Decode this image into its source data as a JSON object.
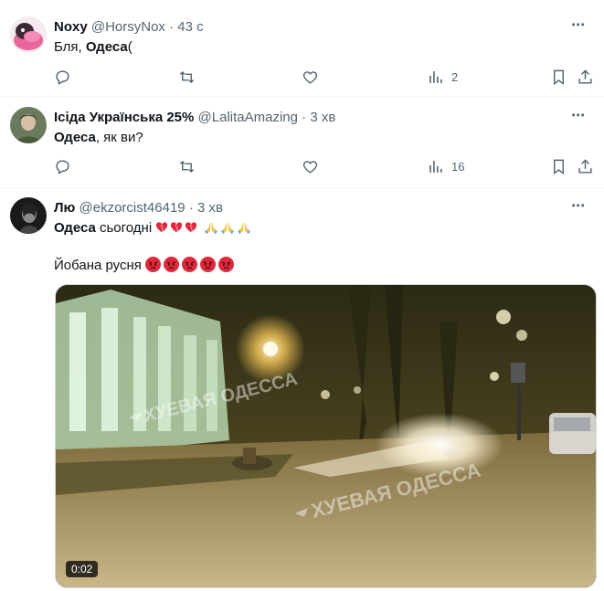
{
  "tweets": [
    {
      "name": "Noxy",
      "handle": "@HorsyNox",
      "time": "· 43 с",
      "text_pre": "Бля, ",
      "text_bold": "Одеса",
      "text_post": "(",
      "views": "2"
    },
    {
      "name": "Ісіда Українська 25%",
      "handle": "@LalitaAmazing",
      "time": "· 3 хв",
      "text_bold": "Одеса",
      "text_post": ", як ви?",
      "views": "16"
    },
    {
      "name": "Лю",
      "handle": "@ekzorcist46419",
      "time": "· 3 хв",
      "text_bold": "Одеса",
      "text_post": " сьогодні",
      "line2": "Йобана русня",
      "video": {
        "duration": "0:02",
        "watermark": "ХУЕВАЯ ОДЕССА"
      }
    }
  ],
  "more_icon": "⋯",
  "colors": {
    "secondary_text": "#536471",
    "divider": "#eff3f4",
    "heart_emoji": "#e0283c"
  }
}
